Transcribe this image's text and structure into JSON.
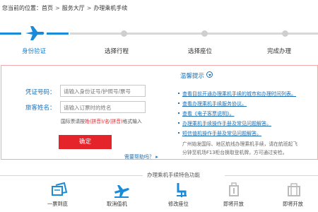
{
  "breadcrumb": {
    "prefix": "您当前的位置：",
    "items": [
      "首页",
      "服务大厅",
      "办理乘机手续"
    ],
    "separator": ">"
  },
  "steps": [
    {
      "label": "身份验证",
      "active": true
    },
    {
      "label": "选择行程",
      "active": false
    },
    {
      "label": "选择座位",
      "active": false
    },
    {
      "label": "完成办理",
      "active": false
    }
  ],
  "form": {
    "doc_label": "凭证号码：",
    "doc_placeholder": "请输入身份证号/护照号/票号",
    "name_label": "旅客姓名：",
    "name_placeholder": "请输入订票时的姓名",
    "hint_prefix": "国际票请按",
    "hint_highlight": "姓(拼音)/名(拼音)",
    "hint_suffix": "格式输入",
    "confirm_label": "确定",
    "help_label": "需要帮助吗？ ▸"
  },
  "tips": {
    "title": "温馨提示",
    "links": [
      "查看目前开通办理乘机手续的城市和办理时间列表。",
      "查看办理乘机手续服务协议。",
      "查看《电子客票说明》。",
      "办理乘机手续操作手册及常见问题解答。",
      "短信值机操作手册及常见问题解答。"
    ],
    "note_line1": "广州始发国际、地区航线办理乘机手续，请在航班起飞",
    "note_line2": "分钟至机场F13柜台换取登机牌，方可通过安检。"
  },
  "features": {
    "title": "办理乘机手续特色功能",
    "items": [
      {
        "label": "一票到底",
        "icon": "ticket-icon",
        "active": true
      },
      {
        "label": "取消值机",
        "icon": "plane-cancel-icon",
        "active": true
      },
      {
        "label": "修改座位",
        "icon": "seat-icon",
        "active": true
      },
      {
        "label": "即将开放",
        "icon": "luggage-icon",
        "active": false
      },
      {
        "label": "即将开放",
        "icon": "briefcase-icon",
        "active": false
      }
    ]
  },
  "colors": {
    "accent": "#1a8ad9",
    "link": "#1a6fb5",
    "confirm": "#e5232b",
    "panel_border": "#f0a8a8",
    "disabled": "#bbbbbb"
  }
}
